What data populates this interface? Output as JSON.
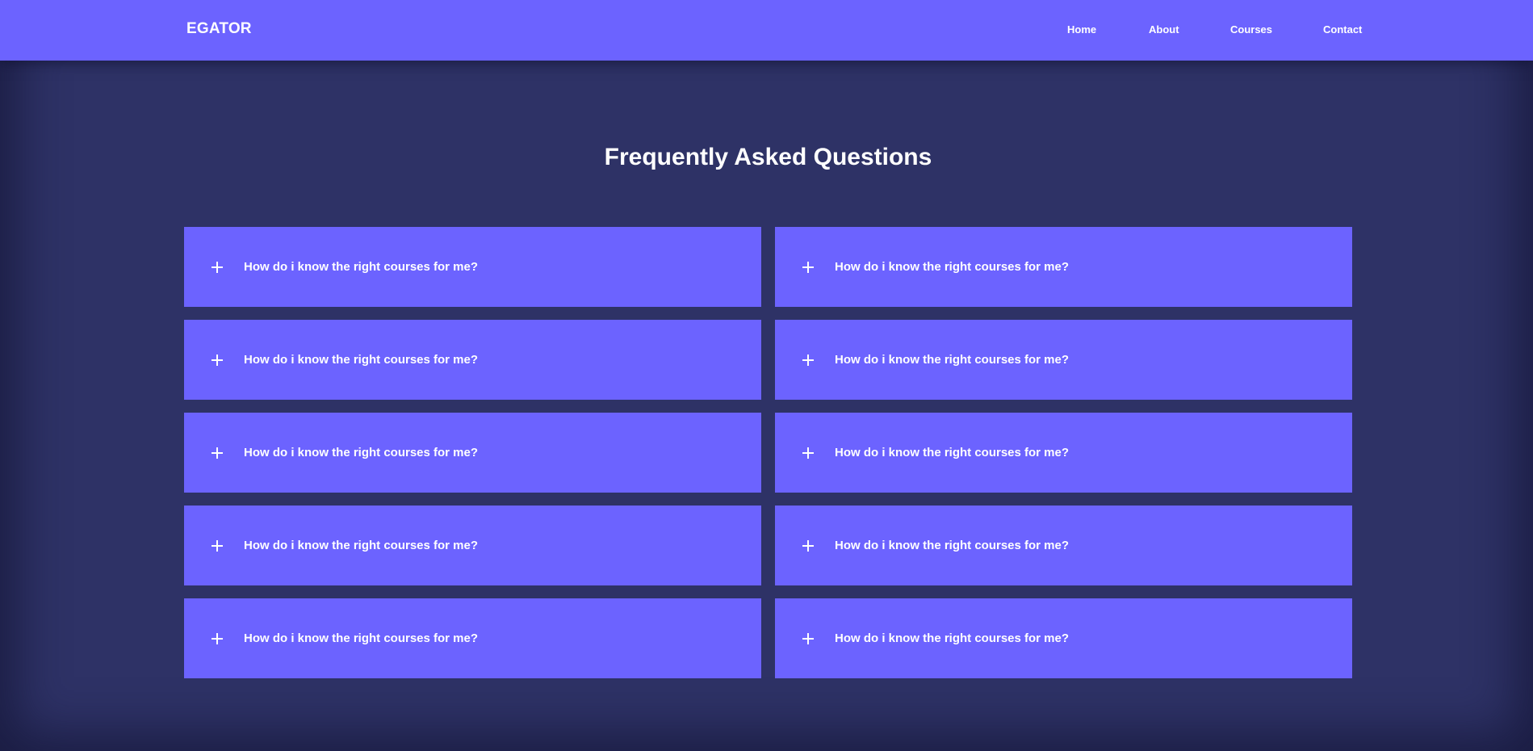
{
  "navbar": {
    "brand": "EGATOR",
    "links": [
      {
        "label": "Home"
      },
      {
        "label": "About"
      },
      {
        "label": "Courses"
      },
      {
        "label": "Contact"
      }
    ]
  },
  "faq": {
    "title": "Frequently Asked Questions",
    "items": [
      {
        "question": "How do i know the right courses for me?",
        "icon": "plus-icon"
      },
      {
        "question": "How do i know the right courses for me?",
        "icon": "plus-icon"
      },
      {
        "question": "How do i know the right courses for me?",
        "icon": "plus-icon"
      },
      {
        "question": "How do i know the right courses for me?",
        "icon": "plus-icon"
      },
      {
        "question": "How do i know the right courses for me?",
        "icon": "plus-icon"
      },
      {
        "question": "How do i know the right courses for me?",
        "icon": "plus-icon"
      },
      {
        "question": "How do i know the right courses for me?",
        "icon": "plus-icon"
      },
      {
        "question": "How do i know the right courses for me?",
        "icon": "plus-icon"
      },
      {
        "question": "How do i know the right courses for me?",
        "icon": "plus-icon"
      },
      {
        "question": "How do i know the right courses for me?",
        "icon": "plus-icon"
      }
    ]
  },
  "colors": {
    "accent": "#6c63ff",
    "background": "#2e3266",
    "text": "#ffffff"
  }
}
